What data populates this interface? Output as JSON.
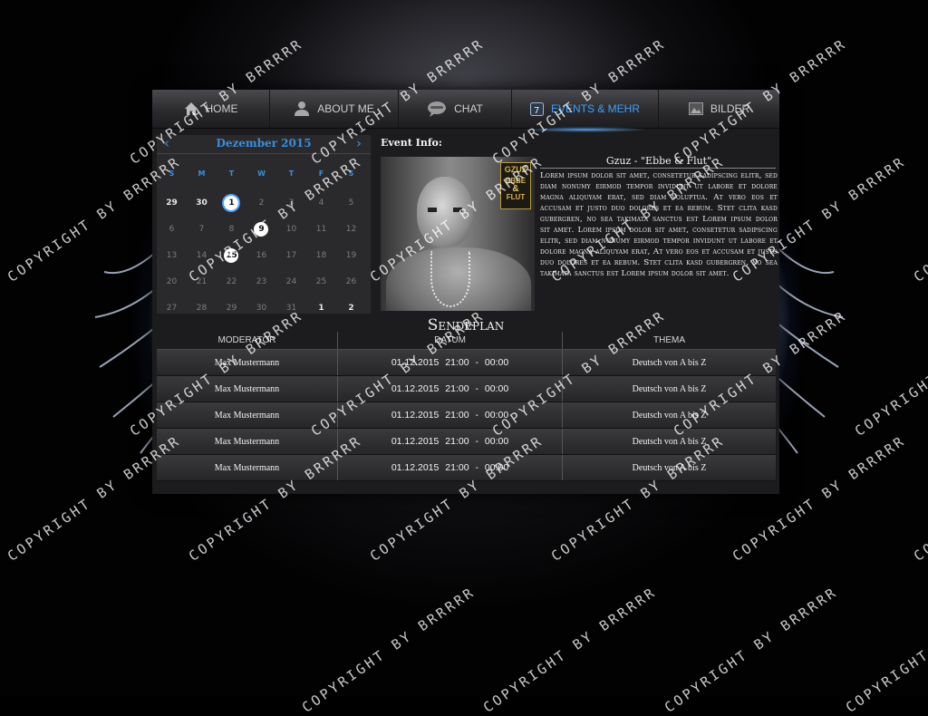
{
  "nav": {
    "items": [
      {
        "label": "HOME",
        "icon": "home-icon"
      },
      {
        "label": "ABOUT ME",
        "icon": "user-icon"
      },
      {
        "label": "CHAT",
        "icon": "chat-bubble-icon"
      },
      {
        "label": "EVENTS & MEHR",
        "icon": "calendar-icon",
        "active": true
      },
      {
        "label": "BILDER",
        "icon": "image-icon"
      }
    ],
    "active_color": "#3aa0ff"
  },
  "calendar": {
    "month_title": "Dezember 2015",
    "prev_arrow": "‹",
    "next_arrow": "›",
    "weekdays": [
      "S",
      "M",
      "T",
      "W",
      "T",
      "F",
      "S"
    ],
    "weeks": [
      [
        "29",
        "30",
        "1",
        "2",
        "3",
        "4",
        "5"
      ],
      [
        "6",
        "7",
        "8",
        "9",
        "10",
        "11",
        "12"
      ],
      [
        "13",
        "14",
        "15",
        "16",
        "17",
        "18",
        "19"
      ],
      [
        "20",
        "21",
        "22",
        "23",
        "24",
        "25",
        "26"
      ],
      [
        "27",
        "28",
        "29",
        "30",
        "31",
        "1",
        "2"
      ]
    ],
    "marked_days": [
      "1",
      "9",
      "15"
    ],
    "today": "1",
    "accent_color": "#3a8ede"
  },
  "event": {
    "heading": "Event Info:",
    "title": "Gzuz - \"Ebbe & Flut\"",
    "album_cover": {
      "line1": "GZUZ",
      "line2": "EBBE",
      "line3": "&",
      "line4": "FLUT"
    },
    "description": "Lorem ipsum dolor sit amet, consetetur sadipscing elitr, sed diam nonumy eirmod tempor invidunt ut labore et dolore magna aliquyam erat, sed diam voluptua. At vero eos et accusam et justo duo dolores et ea rebum. Stet clita kasd gubergren, no sea takimata sanctus est Lorem ipsum dolor sit amet. Lorem ipsum dolor sit amet, consetetur sadipscing elitr, sed diam nonumy eirmod tempor invidunt ut labore et dolore magna aliquyam erat, At vero eos et accusam et justo duo dolores et ea rebum. Stet clita kasd gubergren, no sea takimata sanctus est Lorem ipsum dolor sit amet."
  },
  "schedule": {
    "title": "Sendeplan",
    "columns": [
      "MODERATOR",
      "DATUM",
      "THEMA"
    ],
    "rows": [
      [
        "Max Mustermann",
        "01.12.2015  21:00 - 00:00",
        "Deutsch von A bis Z"
      ],
      [
        "Max Mustermann",
        "01.12.2015  21:00 - 00:00",
        "Deutsch von A bis Z"
      ],
      [
        "Max Mustermann",
        "01.12.2015  21:00 - 00:00",
        "Deutsch von A bis Z"
      ],
      [
        "Max Mustermann",
        "01.12.2015  21:00 - 00:00",
        "Deutsch von A bis Z"
      ],
      [
        "Max Mustermann",
        "01.12.2015  21:00 - 00:00",
        "Deutsch von A bis Z"
      ]
    ]
  },
  "watermark": {
    "text": "COPYRIGHT BY BRRRRR"
  }
}
